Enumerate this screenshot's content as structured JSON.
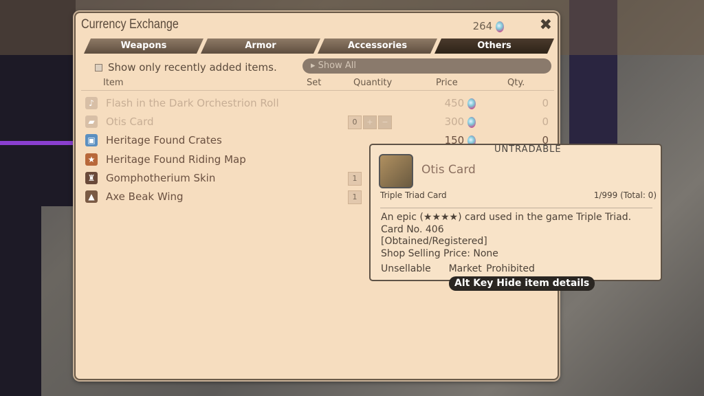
{
  "window": {
    "title": "Currency Exchange",
    "currency_amount": "264",
    "currency_icon": "gem-icon",
    "close_icon": "close-icon"
  },
  "tabs": [
    {
      "label": "Weapons"
    },
    {
      "label": "Armor"
    },
    {
      "label": "Accessories"
    },
    {
      "label": "Others",
      "active": true
    }
  ],
  "filter": {
    "checkbox_label": "Show only recently added items.",
    "checked": false,
    "dropdown_value": "Show All"
  },
  "columns": {
    "item": "Item",
    "set": "Set",
    "quantity": "Quantity",
    "price": "Price",
    "qty": "Qty."
  },
  "items": [
    {
      "name": "Flash in the Dark Orchestrion Roll",
      "quantity": "",
      "price": "450",
      "qty": "0",
      "dim": true,
      "icon": "music-icon"
    },
    {
      "name": "Otis Card",
      "quantity": "0",
      "price": "300",
      "qty": "0",
      "dim": true,
      "icon": "card-icon"
    },
    {
      "name": "Heritage Found Crates",
      "quantity": "",
      "price": "150",
      "qty": "0",
      "dim": false,
      "icon": "crate-icon"
    },
    {
      "name": "Heritage Found Riding Map",
      "quantity": "",
      "price": "",
      "qty": "",
      "dim": false,
      "icon": "map-icon"
    },
    {
      "name": "Gomphotherium Skin",
      "quantity": "1",
      "price": "",
      "qty": "",
      "dim": false,
      "icon": "skin-icon"
    },
    {
      "name": "Axe Beak Wing",
      "quantity": "1",
      "price": "",
      "qty": "",
      "dim": false,
      "icon": "wing-icon"
    }
  ],
  "tooltip": {
    "tag": "UNTRADABLE",
    "name": "Otis Card",
    "type": "Triple Triad Card",
    "count": "1/999 (Total: 0)",
    "description": [
      "An epic (★★★★) card used in the game Triple Triad.",
      "Card No. 406",
      "[Obtained/Registered]",
      "Shop Selling Price: None"
    ],
    "flags": [
      "Unsellable",
      "Market Prohibited"
    ]
  },
  "hint": "Alt Key  Hide item details"
}
